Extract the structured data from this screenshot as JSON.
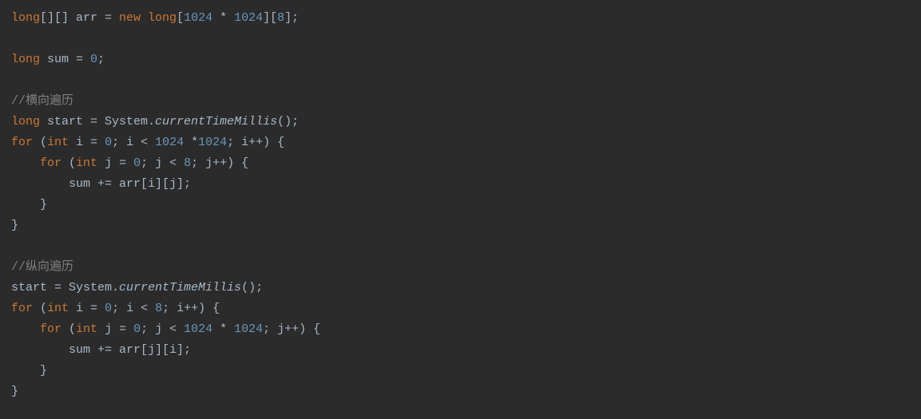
{
  "code": {
    "l1_kw1": "long",
    "l1_punct1": "[][] ",
    "l1_id1": "arr = ",
    "l1_kw2": "new long",
    "l1_punct2": "[",
    "l1_num1": "1024",
    "l1_punct3": " * ",
    "l1_num2": "1024",
    "l1_punct4": "][",
    "l1_num3": "8",
    "l1_punct5": "];",
    "l3_kw1": "long",
    "l3_id1": " sum = ",
    "l3_num1": "0",
    "l3_punct1": ";",
    "l5_comment": "//横向遍历",
    "l6_kw1": "long",
    "l6_id1": " start = System.",
    "l6_method": "currentTimeMillis",
    "l6_punct1": "();",
    "l7_kw1": "for",
    "l7_punct1": " (",
    "l7_kw2": "int",
    "l7_id1": " i = ",
    "l7_num1": "0",
    "l7_punct2": "; i < ",
    "l7_num2": "1024",
    "l7_punct3": " *",
    "l7_num3": "1024",
    "l7_punct4": "; i++) {",
    "l8_indent": "    ",
    "l8_kw1": "for",
    "l8_punct1": " (",
    "l8_kw2": "int",
    "l8_id1": " j = ",
    "l8_num1": "0",
    "l8_punct2": "; j < ",
    "l8_num2": "8",
    "l8_punct3": "; j++) {",
    "l9": "        sum += arr[i][j];",
    "l10": "    }",
    "l11": "}",
    "l13_comment": "//纵向遍历",
    "l14_id1": "start = System.",
    "l14_method": "currentTimeMillis",
    "l14_punct1": "();",
    "l15_kw1": "for",
    "l15_punct1": " (",
    "l15_kw2": "int",
    "l15_id1": " i = ",
    "l15_num1": "0",
    "l15_punct2": "; i < ",
    "l15_num2": "8",
    "l15_punct3": "; i++) {",
    "l16_indent": "    ",
    "l16_kw1": "for",
    "l16_punct1": " (",
    "l16_kw2": "int",
    "l16_id1": " j = ",
    "l16_num1": "0",
    "l16_punct2": "; j < ",
    "l16_num2": "1024",
    "l16_punct3": " * ",
    "l16_num3": "1024",
    "l16_punct4": "; j++) {",
    "l17": "        sum += arr[j][i];",
    "l18": "    }",
    "l19": "}"
  }
}
